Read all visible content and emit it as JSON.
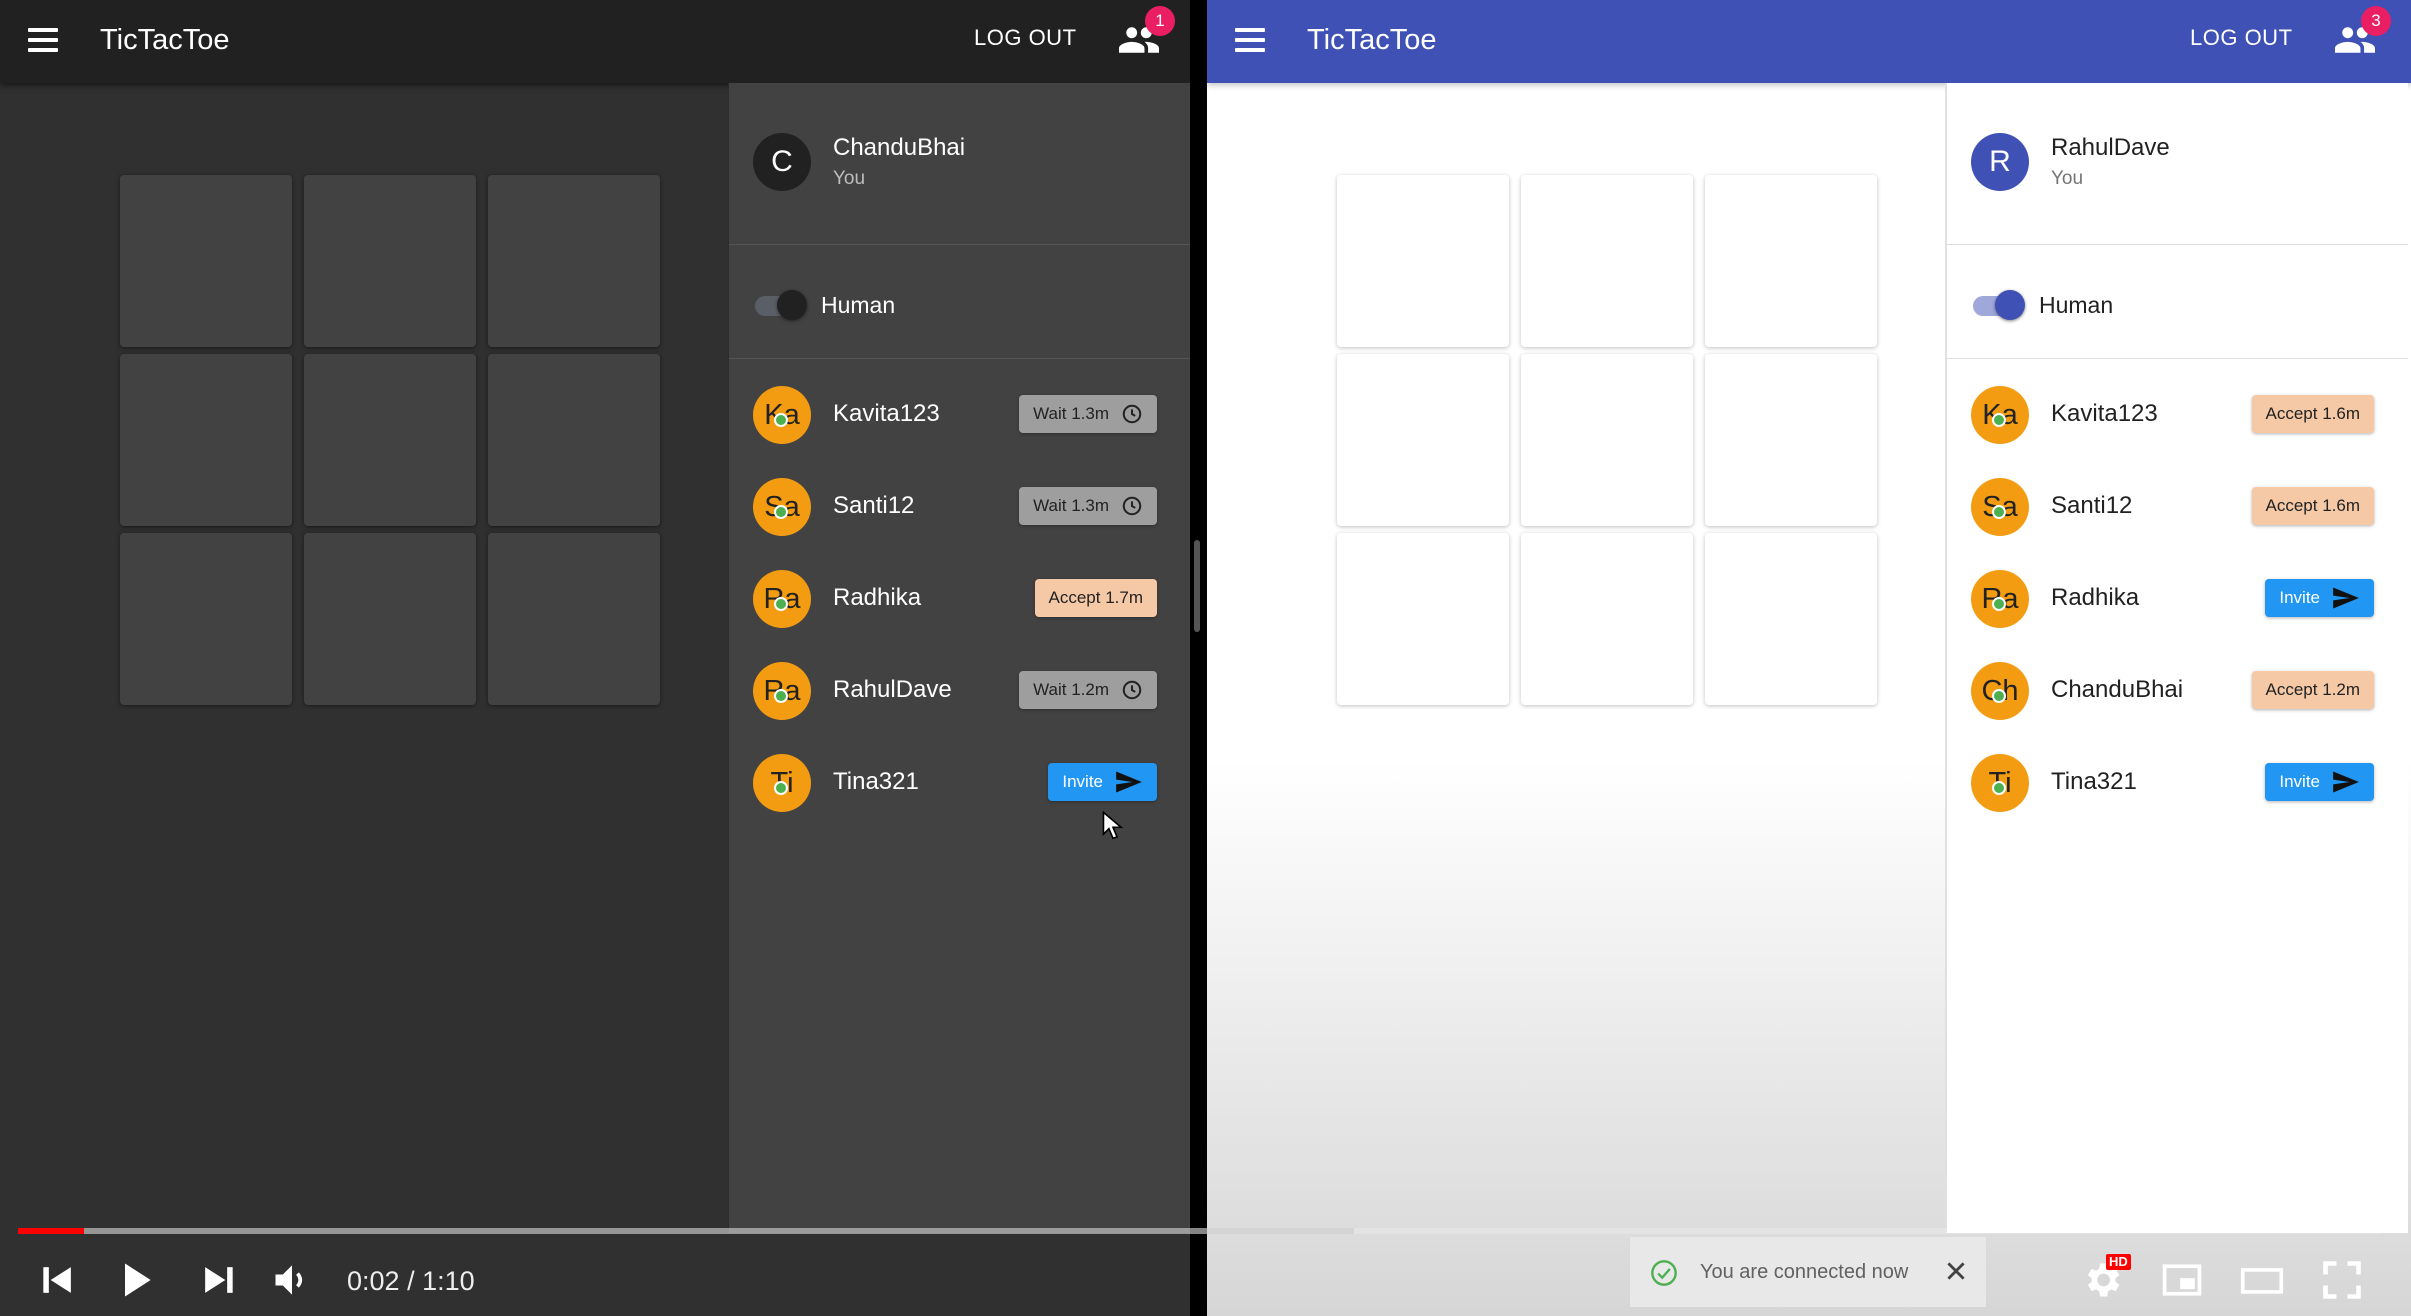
{
  "left": {
    "app_title": "TicTacToe",
    "logout_label": "LOG OUT",
    "notification_count": "1",
    "me": {
      "initial": "C",
      "name": "ChanduBhai",
      "subtitle": "You"
    },
    "mode_label": "Human",
    "players": [
      {
        "initials": "Ka",
        "name": "Kavita123",
        "action": "wait",
        "action_label": "Wait 1.3m",
        "icon": "clock-icon"
      },
      {
        "initials": "Sa",
        "name": "Santi12",
        "action": "wait",
        "action_label": "Wait 1.3m",
        "icon": "clock-icon"
      },
      {
        "initials": "Ra",
        "name": "Radhika",
        "action": "accept",
        "action_label": "Accept 1.7m",
        "icon": ""
      },
      {
        "initials": "Ra",
        "name": "RahulDave",
        "action": "wait",
        "action_label": "Wait 1.2m",
        "icon": "clock-icon"
      },
      {
        "initials": "Ti",
        "name": "Tina321",
        "action": "invite",
        "action_label": "Invite",
        "icon": "send-icon"
      }
    ]
  },
  "right": {
    "app_title": "TicTacToe",
    "logout_label": "LOG OUT",
    "notification_count": "3",
    "me": {
      "initial": "R",
      "name": "RahulDave",
      "subtitle": "You"
    },
    "mode_label": "Human",
    "players": [
      {
        "initials": "Ka",
        "name": "Kavita123",
        "action": "accept",
        "action_label": "Accept 1.6m",
        "icon": ""
      },
      {
        "initials": "Sa",
        "name": "Santi12",
        "action": "accept",
        "action_label": "Accept 1.6m",
        "icon": ""
      },
      {
        "initials": "Ra",
        "name": "Radhika",
        "action": "invite",
        "action_label": "Invite",
        "icon": "send-icon"
      },
      {
        "initials": "Ch",
        "name": "ChanduBhai",
        "action": "accept",
        "action_label": "Accept 1.2m",
        "icon": ""
      },
      {
        "initials": "Ti",
        "name": "Tina321",
        "action": "invite",
        "action_label": "Invite",
        "icon": "send-icon"
      }
    ]
  },
  "toast": {
    "message": "You are connected now"
  },
  "video": {
    "current_time": "0:02",
    "separator": " / ",
    "duration": "1:10",
    "played_fraction": 0.028,
    "buffered_fraction": 0.565,
    "settings_badge": "HD"
  },
  "colors": {
    "dark_appbar": "#212121",
    "light_appbar": "#3f51b5",
    "avatar_orange": "#f39c12",
    "online_green": "#4caf50",
    "invite_blue": "#2196f3",
    "accept_peach": "#f5c9a6",
    "wait_grey": "#9e9e9e",
    "badge_pink": "#e91e63",
    "progress_red": "#ff0000"
  }
}
